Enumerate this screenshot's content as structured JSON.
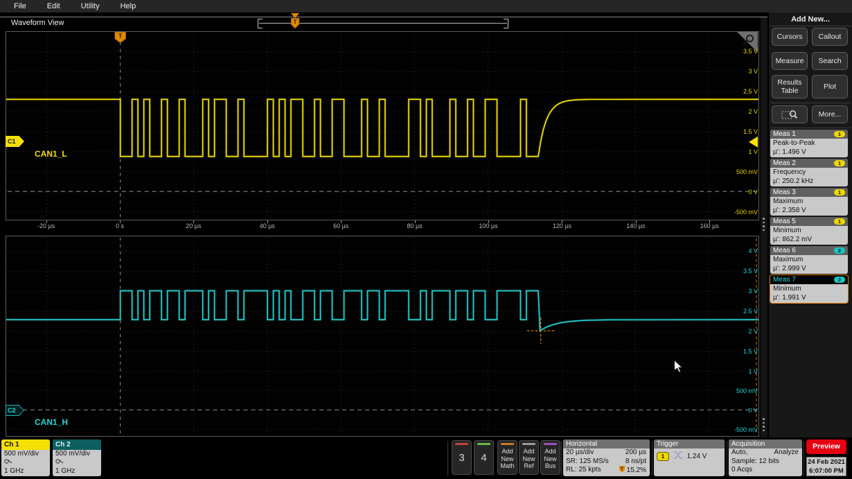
{
  "menu": {
    "items": [
      "File",
      "Edit",
      "Utility",
      "Help"
    ]
  },
  "view": {
    "title": "Waveform View"
  },
  "record_view": {
    "trigger_label": "T"
  },
  "add_new": {
    "title": "Add New...",
    "buttons": [
      "Cursors",
      "Callout",
      "Measure",
      "Search",
      "Results Table",
      "Plot"
    ],
    "zoom_icon": "zoom-mode-icon",
    "more_label": "More..."
  },
  "measurements": [
    {
      "name": "Meas 1",
      "source": "1",
      "label": "Peak-to-Peak",
      "value": "µ': 1.496 V",
      "selected": false
    },
    {
      "name": "Meas 2",
      "source": "1",
      "label": "Frequency",
      "value": "µ': 250.2 kHz",
      "selected": false
    },
    {
      "name": "Meas 3",
      "source": "1",
      "label": "Maximum",
      "value": "µ': 2.358 V",
      "selected": false
    },
    {
      "name": "Meas 5",
      "source": "1",
      "label": "Minimum",
      "value": "µ': 862.2 mV",
      "selected": false
    },
    {
      "name": "Meas 6",
      "source": "2",
      "label": "Maximum",
      "value": "µ': 2.999 V",
      "selected": false
    },
    {
      "name": "Meas 7",
      "source": "2",
      "label": "Minimum",
      "value": "µ': 1.991 V",
      "selected": true
    }
  ],
  "plot": {
    "top": {
      "badge": "C1",
      "label": "CAN1_L",
      "axis": [
        "3.5 V",
        "3 V",
        "2.5 V",
        "2 V",
        "1.5 V",
        "1 V",
        "500 mV",
        "0 V",
        "-500 mV"
      ]
    },
    "bottom": {
      "badge": "C2",
      "label": "CAN1_H",
      "axis": [
        "4 V",
        "3.5 V",
        "3 V",
        "2.5 V",
        "2 V",
        "1.5 V",
        "1 V",
        "500 mV",
        "0 V",
        "-500 mV"
      ]
    },
    "time_axis": [
      "-20 µs",
      "0 s",
      "20 µs",
      "40 µs",
      "60 µs",
      "80 µs",
      "100 µs",
      "120 µs",
      "140 µs",
      "160 µs"
    ]
  },
  "waveform": {
    "burst_start_level": "dominant",
    "burst_pattern_us": [
      3.2,
      1.6,
      1.6,
      1.6,
      3.2,
      1.6,
      3.2,
      1.6,
      4.8,
      1.6,
      1.6,
      3.2,
      3.2,
      1.6,
      6.4,
      1.6,
      1.6,
      1.6,
      1.6,
      3.2,
      3.2,
      1.6,
      3.2,
      3.2,
      4.8,
      1.6,
      3.2,
      1.6,
      6.4,
      3.2,
      1.6,
      1.6,
      4.8,
      1.6,
      3.2,
      1.6,
      3.2,
      3.2,
      6.4,
      1.6,
      3.2
    ],
    "ch1": {
      "recessive_v": 2.32,
      "dominant_v": 0.87
    },
    "ch2": {
      "recessive_v": 2.25,
      "dominant_v": 3.0,
      "undershoot_v": 1.99
    }
  },
  "ch1": {
    "label": "Ch 1",
    "scale": "500 mV/div",
    "bandwidth": "1 GHz"
  },
  "ch2": {
    "label": "Ch 2",
    "scale": "500 mV/div",
    "bandwidth": "1 GHz"
  },
  "channel_buttons": [
    {
      "label": "3",
      "color": "#c04040"
    },
    {
      "label": "4",
      "color": "#6ab840"
    }
  ],
  "add_buttons": [
    {
      "label": "Add New Math",
      "color": "#c87828"
    },
    {
      "label": "Add New Ref",
      "color": "#9a9a9a"
    },
    {
      "label": "Add New Bus",
      "color": "#9a50c0"
    }
  ],
  "horizontal": {
    "title": "Horizontal",
    "scale": "20 µs/div",
    "duration": "200 µs",
    "sample_rate": "SR: 125 MS/s",
    "resolution": "8 ns/pt",
    "record_length": "RL: 25 kpts",
    "position": "15.2%"
  },
  "trigger": {
    "title": "Trigger",
    "source": "1",
    "level": "1.24 V"
  },
  "acquisition": {
    "title": "Acquisition",
    "mode": "Auto,",
    "analyze": "Analyze",
    "sample": "Sample: 12 bits",
    "acqs": "0 Acqs"
  },
  "preview": {
    "label": "Preview",
    "date": "24 Feb 2021",
    "time": "6:07:00 PM"
  },
  "colors": {
    "ch1": "#f5e003",
    "ch2": "#22d2d2",
    "trigger_orange": "#e08a00",
    "badge1": "#f0d800",
    "badge2": "#19c5c5",
    "preview_red": "#e60012"
  }
}
